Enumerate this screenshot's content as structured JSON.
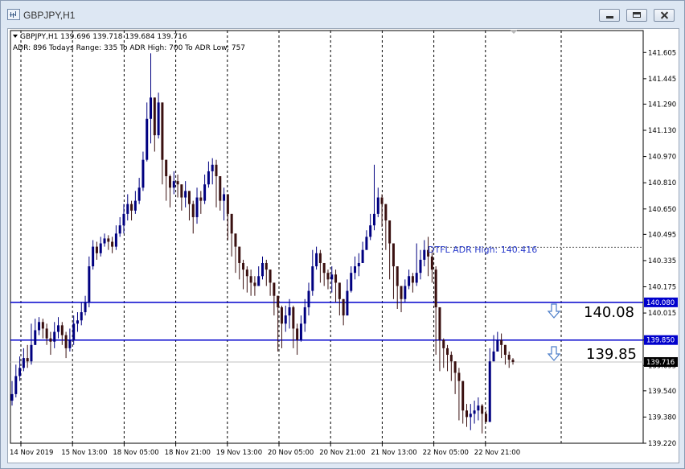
{
  "window": {
    "title": "GBPJPY,H1"
  },
  "chart_header": {
    "line1": "GBPJPY,H1  139.696 139.718 139.684 139.716",
    "line2": "ADR: 896  Todays Range: 335  To ADR High: 700  To ADR Low: 757"
  },
  "annotations": {
    "adr_high": "DTFL ADR High: 140.416",
    "level_upper": "140.08",
    "level_lower": "139.85"
  },
  "chart_data": {
    "type": "candlestick",
    "symbol": "GBPJPY",
    "timeframe": "H1",
    "ylim": [
      139.22,
      141.68
    ],
    "y_ticks": [
      "141.605",
      "141.445",
      "141.290",
      "141.130",
      "140.970",
      "140.810",
      "140.650",
      "140.495",
      "140.335",
      "140.175",
      "140.015",
      "139.850",
      "139.695",
      "139.540",
      "139.380",
      "139.220"
    ],
    "x_ticks": [
      "14 Nov 2019",
      "15 Nov 13:00",
      "18 Nov 05:00",
      "18 Nov 21:00",
      "19 Nov 13:00",
      "20 Nov 05:00",
      "20 Nov 21:00",
      "21 Nov 13:00",
      "22 Nov 05:00",
      "22 Nov 21:00"
    ],
    "levels": [
      {
        "label": "140.080",
        "value": 140.08,
        "color": "#0000cc"
      },
      {
        "label": "139.850",
        "value": 139.85,
        "color": "#0000cc"
      }
    ],
    "adr_high_value": 140.416,
    "current_price_label": "139.716",
    "current_price": 139.716,
    "colors": {
      "bull": "#000080",
      "bear": "#3a1010",
      "grid": "#000000",
      "price_line": "#c0c0c0"
    },
    "closes": [
      139.52,
      139.63,
      139.68,
      139.74,
      139.72,
      139.82,
      139.91,
      139.96,
      139.92,
      139.86,
      139.84,
      139.9,
      139.94,
      139.88,
      139.8,
      139.85,
      139.95,
      139.97,
      140.02,
      140.08,
      140.3,
      140.42,
      140.38,
      140.44,
      140.47,
      140.45,
      140.42,
      140.5,
      140.55,
      140.62,
      140.68,
      140.64,
      140.7,
      140.78,
      140.95,
      141.2,
      141.33,
      141.1,
      141.3,
      140.95,
      140.85,
      140.78,
      140.82,
      140.8,
      140.72,
      140.76,
      140.68,
      140.6,
      140.72,
      140.7,
      140.8,
      140.88,
      140.92,
      140.85,
      140.7,
      140.74,
      140.62,
      140.5,
      140.42,
      140.32,
      140.28,
      140.24,
      140.2,
      140.18,
      140.24,
      140.32,
      140.28,
      140.2,
      140.12,
      140.05,
      139.95,
      140.0,
      140.05,
      139.92,
      139.85,
      139.95,
      140.05,
      140.15,
      140.3,
      140.38,
      140.32,
      140.26,
      140.22,
      140.25,
      140.2,
      140.1,
      140.0,
      140.15,
      140.26,
      140.3,
      140.32,
      140.4,
      140.48,
      140.55,
      140.62,
      140.72,
      140.68,
      140.58,
      140.44,
      140.3,
      140.18,
      140.1,
      140.18,
      140.24,
      140.2,
      140.26,
      140.34,
      140.4,
      140.36,
      140.28,
      140.05,
      139.85,
      139.8,
      139.76,
      139.72,
      139.65,
      139.6,
      139.42,
      139.38,
      139.4,
      139.42,
      139.45,
      139.4,
      139.35,
      139.72,
      139.78,
      139.85,
      139.82,
      139.76,
      139.73,
      139.716
    ],
    "highs": [
      139.6,
      139.7,
      139.75,
      139.8,
      139.82,
      139.95,
      139.98,
      139.99,
      139.98,
      139.95,
      139.9,
      139.96,
      139.99,
      139.96,
      139.9,
      139.92,
      140.0,
      140.02,
      140.08,
      140.12,
      140.36,
      140.46,
      140.45,
      140.48,
      140.5,
      140.49,
      140.48,
      140.55,
      140.6,
      140.68,
      140.74,
      140.7,
      140.76,
      140.84,
      141.0,
      141.3,
      141.6,
      141.32,
      141.36,
      141.0,
      140.92,
      140.86,
      140.88,
      140.86,
      140.8,
      140.82,
      140.74,
      140.7,
      140.78,
      140.76,
      140.86,
      140.94,
      140.96,
      140.95,
      140.8,
      140.78,
      140.7,
      140.58,
      140.48,
      140.4,
      140.34,
      140.3,
      140.28,
      140.24,
      140.3,
      140.36,
      140.34,
      140.28,
      140.18,
      140.1,
      140.06,
      140.06,
      140.1,
      140.06,
      139.95,
      140.0,
      140.1,
      140.2,
      140.4,
      140.42,
      140.4,
      140.32,
      140.28,
      140.3,
      140.28,
      140.2,
      140.1,
      140.22,
      140.3,
      140.36,
      140.38,
      140.45,
      140.52,
      140.62,
      140.92,
      140.78,
      140.74,
      140.66,
      140.52,
      140.36,
      140.24,
      140.16,
      140.22,
      140.28,
      140.26,
      140.44,
      140.4,
      140.46,
      140.48,
      140.4,
      140.3,
      139.9,
      139.86,
      139.82,
      139.78,
      139.72,
      139.68,
      139.52,
      139.46,
      139.46,
      139.48,
      139.5,
      139.46,
      139.42,
      139.8,
      139.88,
      139.9,
      139.89,
      139.82,
      139.78,
      139.74
    ],
    "lows": [
      139.45,
      139.5,
      139.6,
      139.66,
      139.68,
      139.7,
      139.84,
      139.88,
      139.86,
      139.82,
      139.76,
      139.8,
      139.86,
      139.82,
      139.74,
      139.78,
      139.82,
      139.9,
      139.94,
      140.0,
      140.05,
      140.28,
      140.34,
      140.36,
      140.42,
      140.4,
      140.38,
      140.4,
      140.48,
      140.5,
      140.58,
      140.58,
      140.62,
      140.68,
      140.76,
      140.94,
      141.05,
      141.0,
      141.08,
      140.8,
      140.7,
      140.66,
      140.74,
      140.72,
      140.64,
      140.66,
      140.58,
      140.5,
      140.56,
      140.62,
      140.68,
      140.78,
      140.8,
      140.66,
      140.64,
      140.58,
      140.46,
      140.36,
      140.26,
      140.22,
      140.16,
      140.14,
      140.12,
      140.12,
      140.18,
      140.22,
      140.18,
      140.12,
      140.0,
      139.78,
      139.8,
      139.9,
      139.92,
      139.8,
      139.76,
      139.84,
      139.9,
      140.0,
      140.12,
      140.28,
      140.2,
      140.18,
      140.16,
      140.14,
      140.08,
      140.0,
      139.94,
      140.0,
      140.14,
      140.22,
      140.24,
      140.32,
      140.4,
      140.46,
      140.52,
      140.6,
      140.54,
      140.4,
      140.22,
      140.1,
      140.04,
      140.02,
      140.08,
      140.16,
      140.14,
      140.18,
      140.22,
      140.3,
      140.24,
      140.2,
      139.76,
      139.66,
      139.68,
      139.66,
      139.6,
      139.52,
      139.36,
      139.34,
      139.32,
      139.3,
      139.34,
      139.36,
      139.28,
      139.46,
      139.68,
      139.74,
      139.8,
      139.74,
      139.7,
      139.68,
      139.7
    ]
  }
}
